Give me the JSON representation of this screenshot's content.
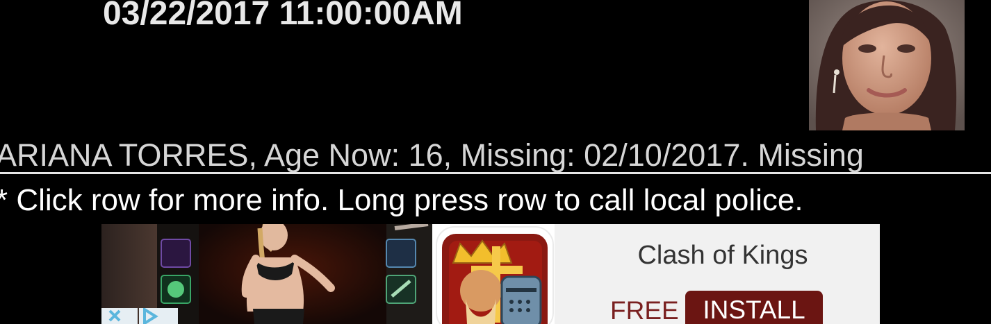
{
  "alert": {
    "datetime": "03/22/2017 11:00:00AM",
    "row_text": "ARIANA TORRES, Age Now: 16, Missing: 02/10/2017. Missing",
    "hint": "* Click row for more info. Long press row to call local police."
  },
  "ad": {
    "title": "Clash of Kings",
    "free_label": "FREE",
    "install_label": "INSTALL"
  },
  "colors": {
    "background": "#000000",
    "install_button": "#6b1512",
    "free_text": "#7a2020"
  },
  "icons": [
    "person-photo",
    "game-banner",
    "clash-of-kings-app-icon",
    "ad-close-icon",
    "adchoices-icon"
  ]
}
